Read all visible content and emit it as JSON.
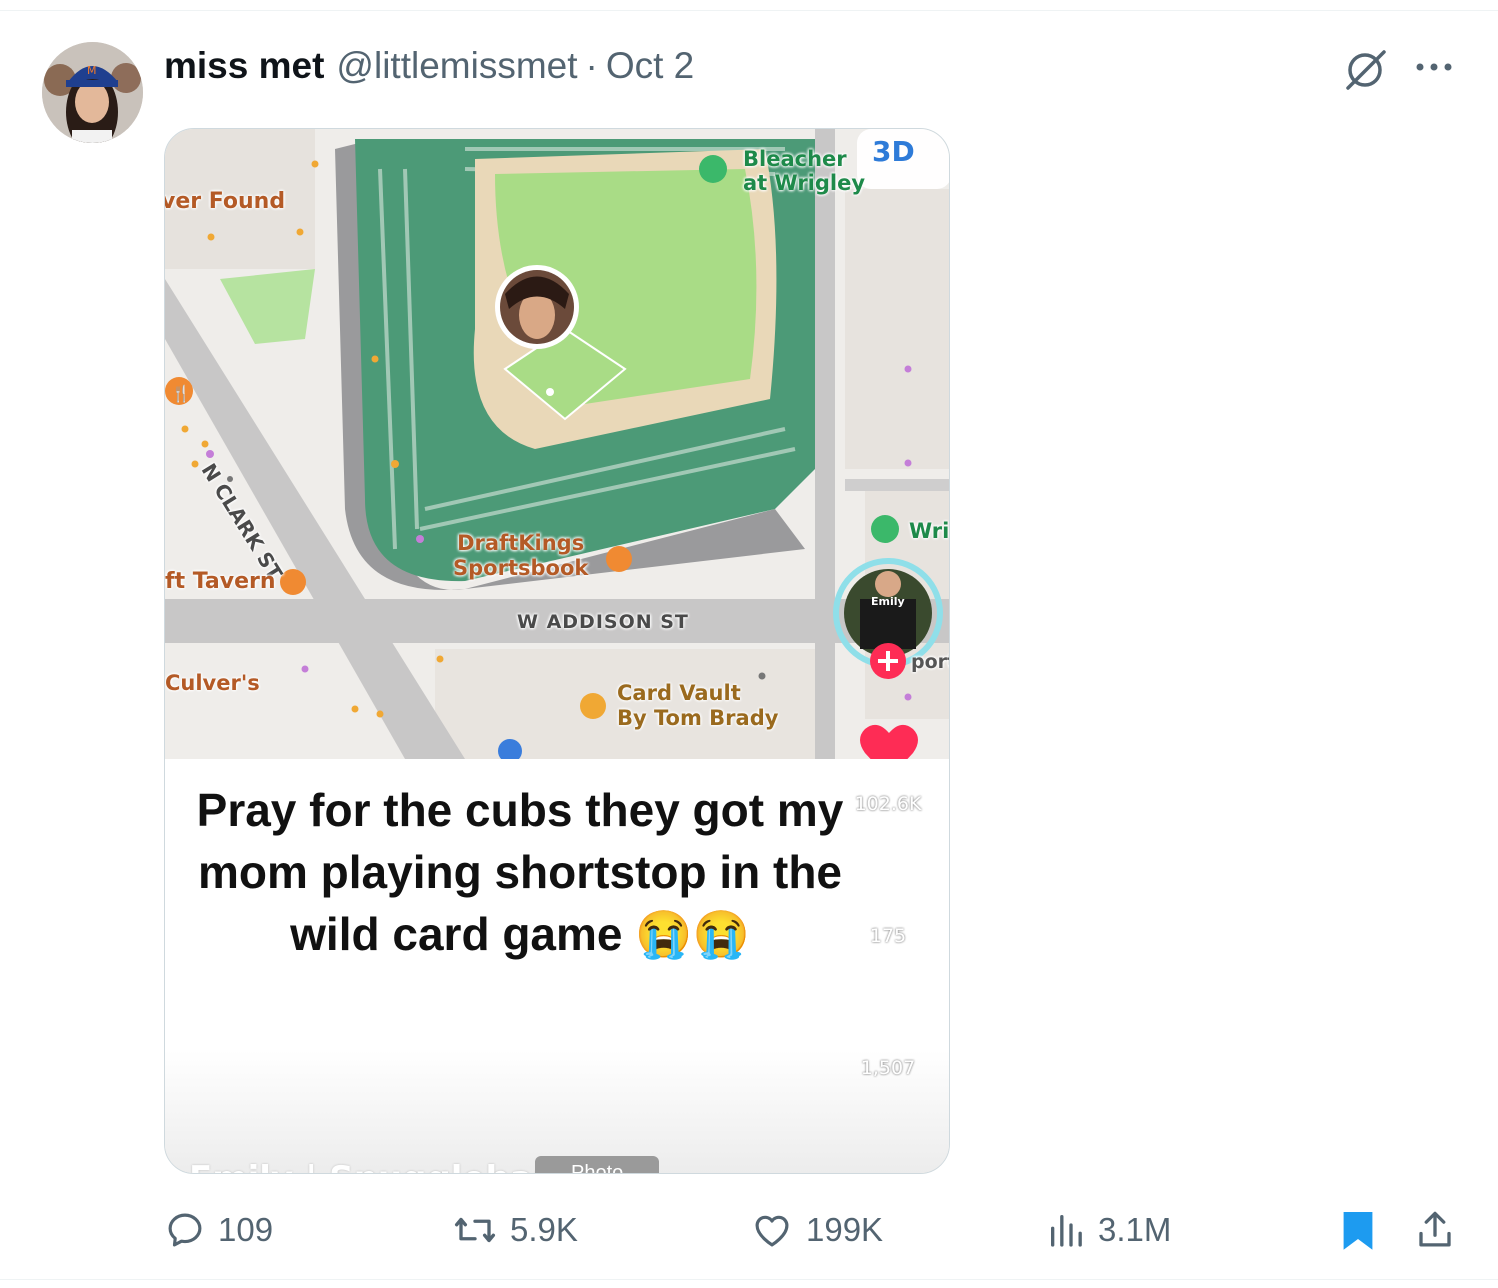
{
  "tweet": {
    "author_name": "miss met",
    "author_handle": "@littlemissmet",
    "separator": "·",
    "date": "Oct 2"
  },
  "media": {
    "map_labels": {
      "ever_found": "ver Found",
      "bleacher_line1": "Bleacher",
      "bleacher_line2": "at Wrigley",
      "three_d": "3D",
      "clark_st": "N CLARK ST",
      "draftkings_line1": "DraftKings",
      "draftkings_line2": "Sportsbook",
      "tavern": "ft Tavern",
      "addison_st": "W ADDISON ST",
      "culvers": "Culver's",
      "card_vault_line1": "Card Vault",
      "card_vault_line2": "By Tom Brady",
      "wri": "Wri",
      "port": "port",
      "profile_shirt": "Emily"
    },
    "caption": "Pray for the cubs they got my mom playing shortstop in the wild card game 😭😭",
    "likes": "102.6K",
    "comments": "175",
    "saves": "1,507",
    "footer_name": "Emily | Snugglebangs",
    "photo_label": "Photo"
  },
  "actions": {
    "replies": "109",
    "reposts": "5.9K",
    "likes": "199K",
    "views": "3.1M"
  },
  "colors": {
    "secondary_text": "#536471",
    "bookmark_blue": "#1d9bf0",
    "tiktok_red": "#fe2c55",
    "field_green": "#a9dc86",
    "stands_green": "#3e8a6a"
  }
}
